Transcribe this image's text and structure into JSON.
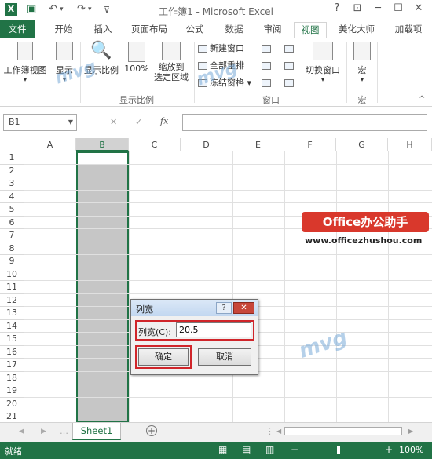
{
  "window": {
    "title": "工作簿1 - Microsoft Excel",
    "app_icon": "X",
    "controls": [
      "?",
      "⊡",
      "─",
      "☐",
      "✕"
    ]
  },
  "tabs": {
    "file": "文件",
    "items": [
      "开始",
      "插入",
      "页面布局",
      "公式",
      "数据",
      "审阅",
      "视图",
      "美化大师",
      "加载项"
    ],
    "active": "视图"
  },
  "ribbon": {
    "workbook_view": "工作簿视图",
    "show": "显示",
    "zoom": "显示比例",
    "zoom100": "100%",
    "zoom_selection": [
      "缩放到",
      "选定区域"
    ],
    "group_zoom": "显示比例",
    "new_window": "新建窗口",
    "arrange_all": "全部重排",
    "freeze_panes": "冻结窗格",
    "group_window": "窗口",
    "switch_window": "切换窗口",
    "macro": "宏",
    "group_macro": "宏"
  },
  "formula_bar": {
    "name_box": "B1",
    "fx": "fx",
    "cancel": "✕",
    "enter": "✓",
    "value": ""
  },
  "grid": {
    "columns": [
      "A",
      "B",
      "C",
      "D",
      "E",
      "F",
      "G",
      "H"
    ],
    "rows": [
      "1",
      "2",
      "3",
      "4",
      "5",
      "6",
      "7",
      "8",
      "9",
      "10",
      "11",
      "12",
      "13",
      "14",
      "15",
      "16",
      "17",
      "18",
      "19",
      "20",
      "21"
    ],
    "selected_column": "B"
  },
  "dialog": {
    "title": "列宽",
    "help": "?",
    "close": "✕",
    "label": "列宽(C):",
    "value": "20.5",
    "ok": "确定",
    "cancel": "取消"
  },
  "sheets": {
    "tabs": [
      "Sheet1"
    ],
    "add": "+"
  },
  "status": {
    "text": "就绪",
    "zoom": "100%"
  },
  "watermark": {
    "brand": "Office办公助手",
    "url": "www.officezhushou.com"
  }
}
